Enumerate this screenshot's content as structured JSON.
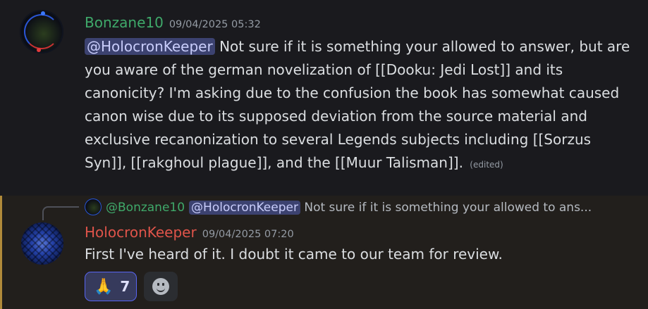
{
  "messages": [
    {
      "author": "Bonzane10",
      "author_color": "#3fa96a",
      "timestamp": "09/04/2025 05:32",
      "mention": "@HolocronKeeper",
      "text": "Not sure if it is something your allowed to answer, but are you aware of the german novelization of [[Dooku: Jedi Lost]] and its canonicity? I'm asking due to the confusion the book has somewhat caused canon wise due to its supposed deviation from the source material and exclusive recanonization to several Legends subjects including [[Sorzus Syn]], [[rakghoul plague]], and the [[Muur Talisman]].",
      "edited_label": "(edited)"
    },
    {
      "reply_to": {
        "author": "@Bonzane10",
        "mention": "@HolocronKeeper",
        "snippet": "Not sure if it is something your allowed to ans..."
      },
      "author": "HolocronKeeper",
      "author_color": "#e0544a",
      "timestamp": "09/04/2025 07:20",
      "text": "First I've heard of it. I doubt it came to our team for review.",
      "reactions": [
        {
          "emoji": "🙏",
          "count": "7",
          "selected": true
        }
      ],
      "add_reaction_icon": "smiley-icon"
    }
  ],
  "colors": {
    "mention_bg": "#3c4270",
    "accent_highlight": "#b08a3a",
    "reaction_border": "#5865f2"
  }
}
